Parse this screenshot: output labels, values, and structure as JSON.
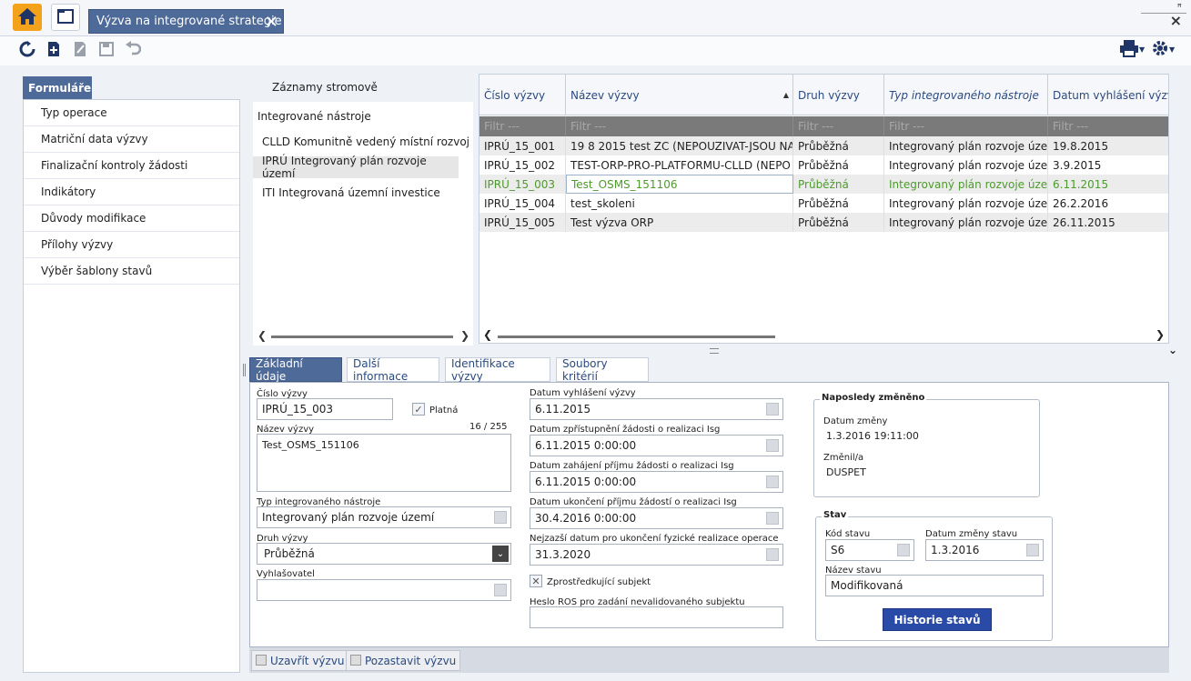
{
  "window": {
    "tab_title": "Výzva na integrované strategie",
    "close_glyph": "✕",
    "pin_glyph": "ꟸ",
    "close_window_glyph": "×"
  },
  "icons": {
    "home": "home-icon",
    "document": "document-icon",
    "refresh": "refresh-icon",
    "add": "add-icon",
    "edit": "edit-icon",
    "save": "save-icon",
    "undo": "undo-icon",
    "print": "print-icon",
    "settings": "gear-icon"
  },
  "colors": {
    "accent": "#4e6a99",
    "home": "#f4a21b",
    "selected_row_text": "#4e9a2e",
    "button_blue": "#2a4aa8"
  },
  "left": {
    "tab_label": "Formuláře",
    "items": [
      "Typ operace",
      "Matriční data výzvy",
      "Finalizační kontroly žádosti",
      "Indikátory",
      "Důvody modifikace",
      "Přílohy výzvy",
      "Výběr šablony stavů"
    ]
  },
  "tree": {
    "title": "Záznamy stromově",
    "items": [
      "Integrované nástroje",
      "CLLD Komunitně vedený místní rozvoj",
      "IPRÚ Integrovaný plán rozvoje území",
      "ITI Integrovaná územní investice"
    ]
  },
  "grid": {
    "headers": [
      "Číslo výzvy",
      "Název výzvy",
      "Druh výzvy",
      "Typ integrovaného nástroje",
      "Datum vyhlášení výzvy"
    ],
    "filter_placeholder": "Filtr ---",
    "rows": [
      [
        "IPRÚ_15_001",
        "19 8 2015 test ZC (NEPOUZIVAT-JSOU NA",
        "Průběžná",
        "Integrovaný plán rozvoje územ",
        "19.8.2015"
      ],
      [
        "IPRÚ_15_002",
        "TEST-ORP-PRO-PLATFORMU-CLLD (NEPO",
        "Průběžná",
        "Integrovaný plán rozvoje územ",
        "3.9.2015"
      ],
      [
        "IPRÚ_15_003",
        "Test_OSMS_151106",
        "Průběžná",
        "Integrovaný plán rozvoje územ",
        "6.11.2015"
      ],
      [
        "IPRÚ_15_004",
        "test_skoleni",
        "Průběžná",
        "Integrovaný plán rozvoje územ",
        "26.2.2016"
      ],
      [
        "IPRÚ_15_005",
        "Test výzva ORP",
        "Průběžná",
        "Integrovaný plán rozvoje územ",
        "26.11.2015"
      ]
    ],
    "selected_row": 2
  },
  "tabs": [
    "Základní údaje",
    "Další informace",
    "Identifikace výzvy",
    "Soubory kritérií"
  ],
  "form": {
    "cislo_label": "Číslo výzvy",
    "cislo_value": "IPRÚ_15_003",
    "platna_label": "Platná",
    "nazev_label": "Název výzvy",
    "nazev_counter": "16 / 255",
    "nazev_value": "Test_OSMS_151106",
    "typ_label": "Typ integrovaného nástroje",
    "typ_value": "Integrovaný plán rozvoje území",
    "druh_label": "Druh výzvy",
    "druh_value": "Průběžná",
    "vyhlasovatel_label": "Vyhlašovatel",
    "vyhlasovatel_value": "",
    "datum_vyhlaseni_label": "Datum vyhlášení výzvy",
    "datum_vyhlaseni_value": "6.11.2015",
    "datum_zpristupneni_label": "Datum zpřístupnění žádosti o realizaci Isg",
    "datum_zpristupneni_value": "6.11.2015 0:00:00",
    "datum_zahajeni_label": "Datum zahájení příjmu žádosti o realizaci Isg",
    "datum_zahajeni_value": "6.11.2015 0:00:00",
    "datum_ukonceni_label": "Datum ukončení příjmu žádostí o realizaci Isg",
    "datum_ukonceni_value": "30.4.2016 0:00:00",
    "nejzazsi_label": "Nejzazší datum pro ukončení fyzické realizace operace",
    "nejzazsi_value": "31.3.2020",
    "zprostredkujici_label": "Zprostředkující subjekt",
    "heslo_label": "Heslo ROS pro zadání nevalidovaného subjektu",
    "heslo_value": ""
  },
  "last_changed": {
    "title": "Naposledy změněno",
    "datum_label": "Datum změny",
    "datum_value": "1.3.2016 19:11:00",
    "zmenil_label": "Změnil/a",
    "zmenil_value": "DUSPET"
  },
  "stav": {
    "title": "Stav",
    "kod_label": "Kód stavu",
    "kod_value": "S6",
    "datum_label": "Datum změny stavu",
    "datum_value": "1.3.2016",
    "nazev_label": "Název stavu",
    "nazev_value": "Modifikovaná",
    "historie_button": "Historie stavů"
  },
  "bottom": {
    "uzavrit": "Uzavřít výzvu",
    "pozastavit": "Pozastavit výzvu"
  }
}
